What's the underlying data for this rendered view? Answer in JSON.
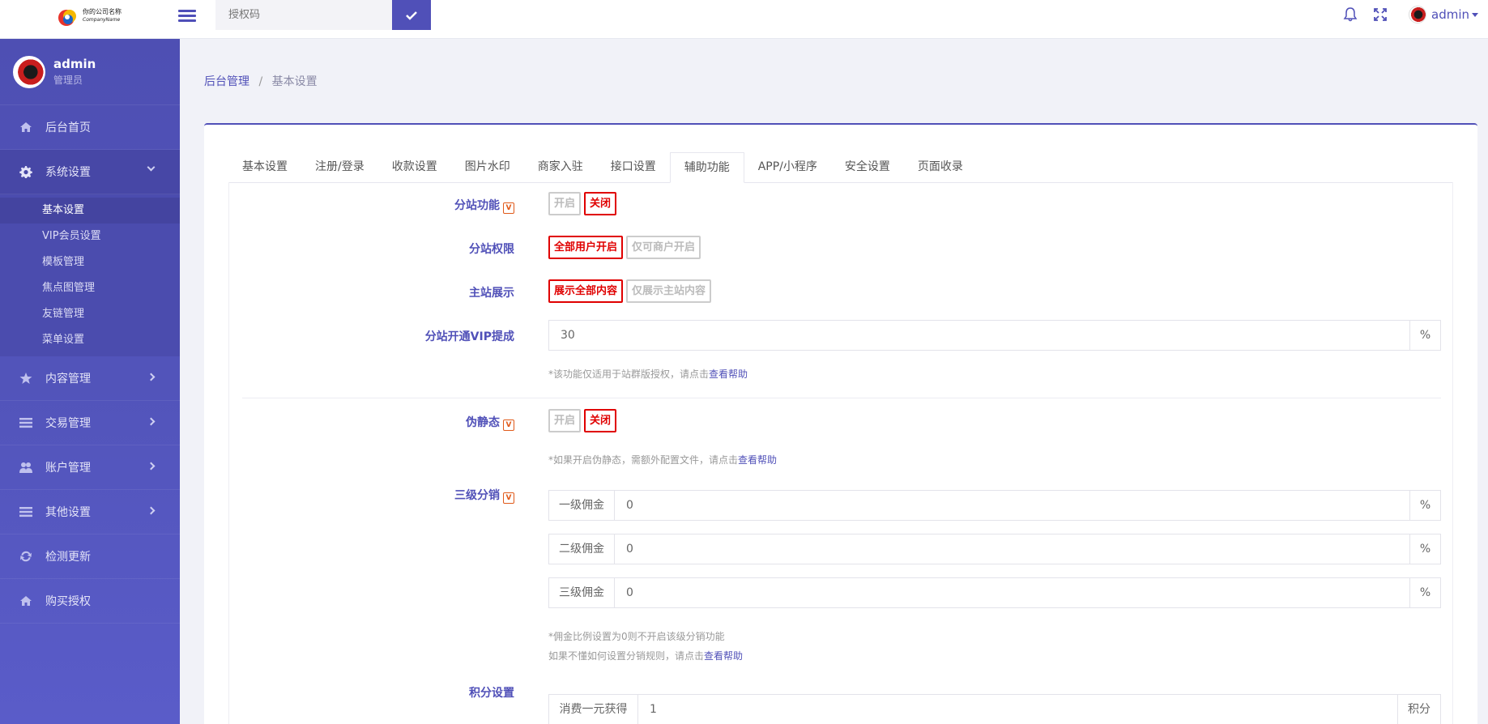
{
  "header": {
    "logo_line1": "你的公司名称",
    "logo_line2": "CompanyName",
    "auth_placeholder": "授权码",
    "user_name": "admin"
  },
  "sidebar": {
    "user_name": "admin",
    "user_role": "管理员",
    "items": [
      {
        "label": "后台首页",
        "icon": "home-icon"
      },
      {
        "label": "系统设置",
        "icon": "gear-icon"
      },
      {
        "label": "内容管理",
        "icon": "star-icon"
      },
      {
        "label": "交易管理",
        "icon": "list-icon"
      },
      {
        "label": "账户管理",
        "icon": "users-icon"
      },
      {
        "label": "其他设置",
        "icon": "list-icon"
      },
      {
        "label": "检测更新",
        "icon": "refresh-icon"
      },
      {
        "label": "购买授权",
        "icon": "home-icon"
      }
    ],
    "submenu": [
      "基本设置",
      "VIP会员设置",
      "模板管理",
      "焦点图管理",
      "友链管理",
      "菜单设置"
    ]
  },
  "breadcrumb": {
    "root": "后台管理",
    "sep": "/",
    "current": "基本设置"
  },
  "tabs": [
    "基本设置",
    "注册/登录",
    "收款设置",
    "图片水印",
    "商家入驻",
    "接口设置",
    "辅助功能",
    "APP/小程序",
    "安全设置",
    "页面收录"
  ],
  "form": {
    "substation": {
      "label": "分站功能",
      "badge": "V",
      "on": "开启",
      "off": "关闭",
      "selected": "off"
    },
    "sub_permission": {
      "label": "分站权限",
      "opt1": "全部用户开启",
      "opt2": "仅可商户开启",
      "selected": "opt1"
    },
    "main_display": {
      "label": "主站展示",
      "opt1": "展示全部内容",
      "opt2": "仅展示主站内容",
      "selected": "opt1"
    },
    "vip_commission": {
      "label": "分站开通VIP提成",
      "value": "30",
      "suffix": "%",
      "help": "*该功能仅适用于站群版授权，请点击",
      "help_link": "查看帮助"
    },
    "pseudo_static": {
      "label": "伪静态",
      "badge": "V",
      "on": "开启",
      "off": "关闭",
      "selected": "off",
      "help": "*如果开启伪静态，需额外配置文件，请点击",
      "help_link": "查看帮助"
    },
    "distribution": {
      "label": "三级分销",
      "badge": "V",
      "levels": [
        {
          "prefix": "一级佣金",
          "value": "0",
          "suffix": "%"
        },
        {
          "prefix": "二级佣金",
          "value": "0",
          "suffix": "%"
        },
        {
          "prefix": "三级佣金",
          "value": "0",
          "suffix": "%"
        }
      ],
      "help1": "*佣金比例设置为0则不开启该级分销功能",
      "help2": "如果不懂如何设置分销规则，请点击",
      "help_link": "查看帮助"
    },
    "points": {
      "label": "积分设置",
      "prefix": "消费一元获得",
      "value": "1",
      "suffix": "积分"
    }
  }
}
